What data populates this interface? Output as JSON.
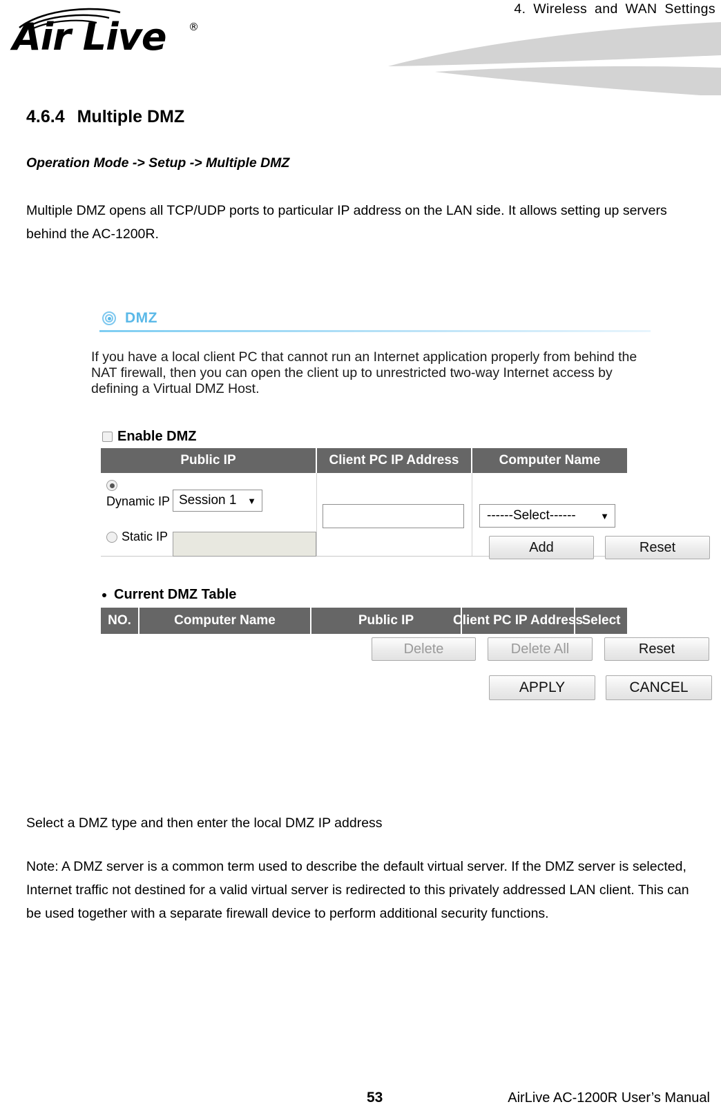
{
  "header": {
    "running_title": "4.  Wireless  and  WAN  Settings",
    "logo_text": "Air Live",
    "logo_trademark": "®"
  },
  "section": {
    "number": "4.6.4",
    "title": "Multiple DMZ",
    "breadcrumb": "Operation Mode -> Setup -> Multiple DMZ",
    "intro": "Multiple DMZ opens all TCP/UDP ports to particular IP address on the LAN side. It allows setting up servers behind the AC-1200R."
  },
  "ui": {
    "panel_title": "DMZ",
    "panel_icon": "target-icon",
    "accent_color": "#5bb9e8",
    "description": "If you have a local client PC that cannot run an Internet application properly from behind the NAT firewall, then you can open the client up to unrestricted two-way Internet access by defining a Virtual DMZ Host.",
    "enable_checkbox_label": "Enable DMZ",
    "enable_checkbox_checked": false,
    "entry_table": {
      "headers": [
        "Public IP",
        "Client PC IP Address",
        "Computer Name"
      ],
      "dynamic_ip_label": "Dynamic IP",
      "dynamic_ip_selected": true,
      "session_select_value": "Session 1",
      "static_ip_label": "Static IP",
      "static_ip_selected": false,
      "static_ip_value": "",
      "client_pc_ip_value": "",
      "computer_name_select_value": "------Select------"
    },
    "add_button": "Add",
    "reset_button": "Reset",
    "current_table_label": "Current DMZ Table",
    "current_table": {
      "headers": [
        "NO.",
        "Computer Name",
        "Public IP",
        "Client PC IP Address",
        "Select"
      ],
      "rows": []
    },
    "delete_button": "Delete",
    "delete_button_disabled": true,
    "delete_all_button": "Delete All",
    "delete_all_button_disabled": true,
    "reset_button_2": "Reset",
    "apply_button": "APPLY",
    "cancel_button": "CANCEL"
  },
  "body": {
    "closing_line": "Select a DMZ type and then enter the local DMZ IP address",
    "note": "Note: A DMZ server is a common term used to describe the default virtual server. If the DMZ server is selected, Internet traffic not destined for a valid virtual server is redirected to this privately addressed LAN client. This can be used together with a separate firewall device to perform additional security functions."
  },
  "footer": {
    "page_number": "53",
    "manual_title": "AirLive AC-1200R User’s Manual"
  }
}
